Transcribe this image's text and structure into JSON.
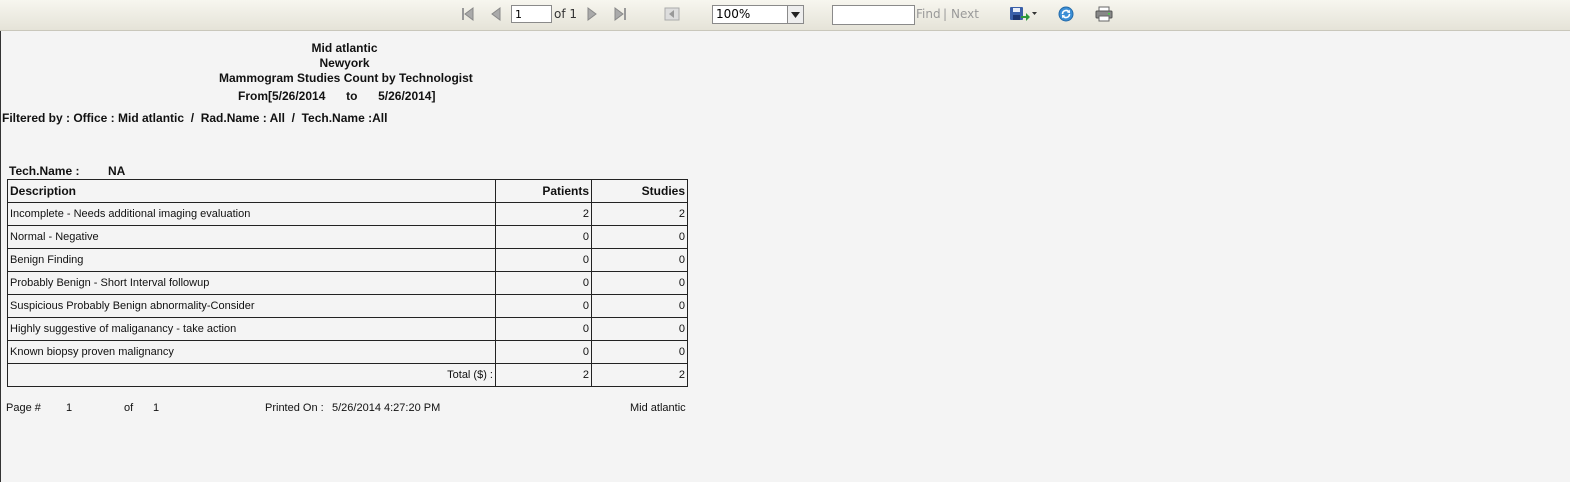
{
  "toolbar": {
    "page_value": "1",
    "of_label": "of 1",
    "zoom": "100%",
    "find_label": "Find",
    "separator": "|",
    "next_label": "Next"
  },
  "report": {
    "header_lines": [
      "Mid atlantic",
      "Newyork",
      "Mammogram Studies Count by Technologist"
    ],
    "date_from_label": "From",
    "date_from": "[5/26/2014",
    "date_to_label": "to",
    "date_to": "5/26/2014]",
    "filter": "Filtered by : Office : Mid atlantic  /  Rad.Name : All  /  Tech.Name :All",
    "tech_label": "Tech.Name :",
    "tech_value": "NA",
    "table": {
      "columns": [
        "Description",
        "Patients",
        "Studies"
      ],
      "rows": [
        [
          "Incomplete - Needs additional imaging evaluation",
          "2",
          "2"
        ],
        [
          "Normal - Negative",
          "0",
          "0"
        ],
        [
          "Benign Finding",
          "0",
          "0"
        ],
        [
          "Probably Benign - Short Interval followup",
          "0",
          "0"
        ],
        [
          "Suspicious Probably Benign abnormality-Consider",
          "0",
          "0"
        ],
        [
          "Highly suggestive of maliganancy - take action",
          "0",
          "0"
        ],
        [
          "Known biopsy proven malignancy",
          "0",
          "0"
        ]
      ],
      "total_label": "Total ($) :",
      "total_patients": "2",
      "total_studies": "2"
    },
    "footer": {
      "page_label": "Page #",
      "page_num": "1",
      "of_label": "of",
      "page_total": "1",
      "printed_label": "Printed On :",
      "printed_value": "5/26/2014 4:27:20 PM",
      "office": "Mid atlantic"
    }
  },
  "icons": {
    "first": "first-page-icon",
    "prev": "previous-page-icon",
    "next": "next-page-icon",
    "last": "last-page-icon",
    "back": "back-to-parent-icon",
    "export": "export-save-icon",
    "refresh": "refresh-icon",
    "print": "print-icon"
  }
}
